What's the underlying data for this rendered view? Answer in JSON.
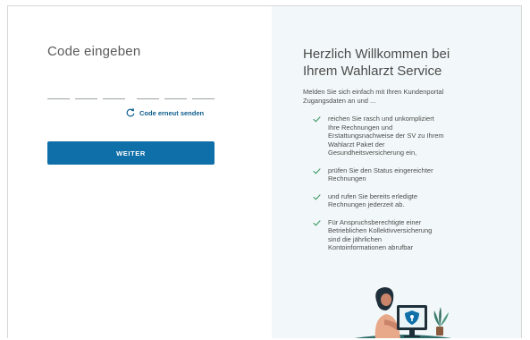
{
  "left": {
    "title": "Code eingeben",
    "resend_label": "Code erneut senden",
    "submit_label": "WEITER"
  },
  "right": {
    "heading_line1": "Herzlich Willkommen bei",
    "heading_line2": "Ihrem Wahlarzt Service",
    "intro_line1": "Melden Sie sich einfach mit Ihren Kundenportal",
    "intro_line2": "Zugangsdaten an und ...",
    "benefits": [
      {
        "lines": [
          "reichen Sie rasch und unkompliziert",
          "Ihre Rechnungen und",
          "Erstattungsnachweise der SV zu Ihrem",
          "Wahlarzt Paket der",
          "Gesundheitsversicherung ein,"
        ]
      },
      {
        "lines": [
          "prüfen Sie den Status eingereichter",
          "Rechnungen"
        ]
      },
      {
        "lines": [
          "und rufen Sie bereits erledigte",
          "Rechnungen jederzeit ab."
        ]
      },
      {
        "lines": [
          "Für Anspruchsberechtigte einer",
          "Betrieblichen Kollektivversicherung",
          "sind die jährlichen",
          "Kontoinformationen abrufbar"
        ]
      }
    ]
  },
  "colors": {
    "primary": "#0f6fa8",
    "link": "#0d5c8c",
    "right_panel_bg": "#f2f8f9",
    "check": "#3f9a6a"
  },
  "icons": {
    "resend": "refresh-icon",
    "benefit": "checkmark-icon",
    "illustration": "woman-with-shield-monitor"
  }
}
